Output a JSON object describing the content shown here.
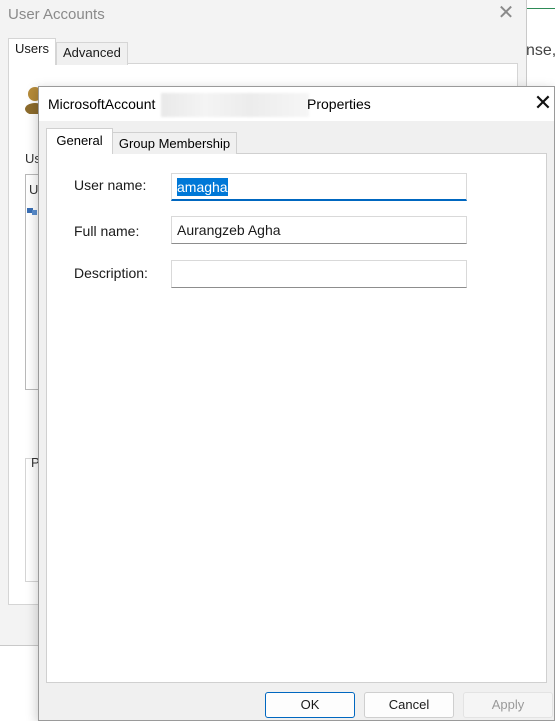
{
  "background_window": {
    "title": "User Accounts",
    "close_glyph": "✕",
    "tabs": [
      {
        "label": "Users"
      },
      {
        "label": "Advanced"
      }
    ],
    "users_label_partial": "Us",
    "list_text_partial": "U",
    "password_label_partial": "P"
  },
  "behind_text_partial": "nse,",
  "dialog": {
    "title_prefix": "MicrosoftAccount",
    "title_suffix": "Properties",
    "close_glyph": "✕",
    "tabs": [
      {
        "label": "General"
      },
      {
        "label": "Group Membership"
      }
    ],
    "fields": {
      "user_name": {
        "label": "User name:",
        "value": "amagha"
      },
      "full_name": {
        "label": "Full name:",
        "value": "Aurangzeb Agha"
      },
      "description": {
        "label": "Description:",
        "value": ""
      }
    },
    "buttons": {
      "ok": "OK",
      "cancel": "Cancel",
      "apply": "Apply"
    }
  },
  "colors": {
    "accent": "#0067c0",
    "selection": "#0078d7"
  }
}
